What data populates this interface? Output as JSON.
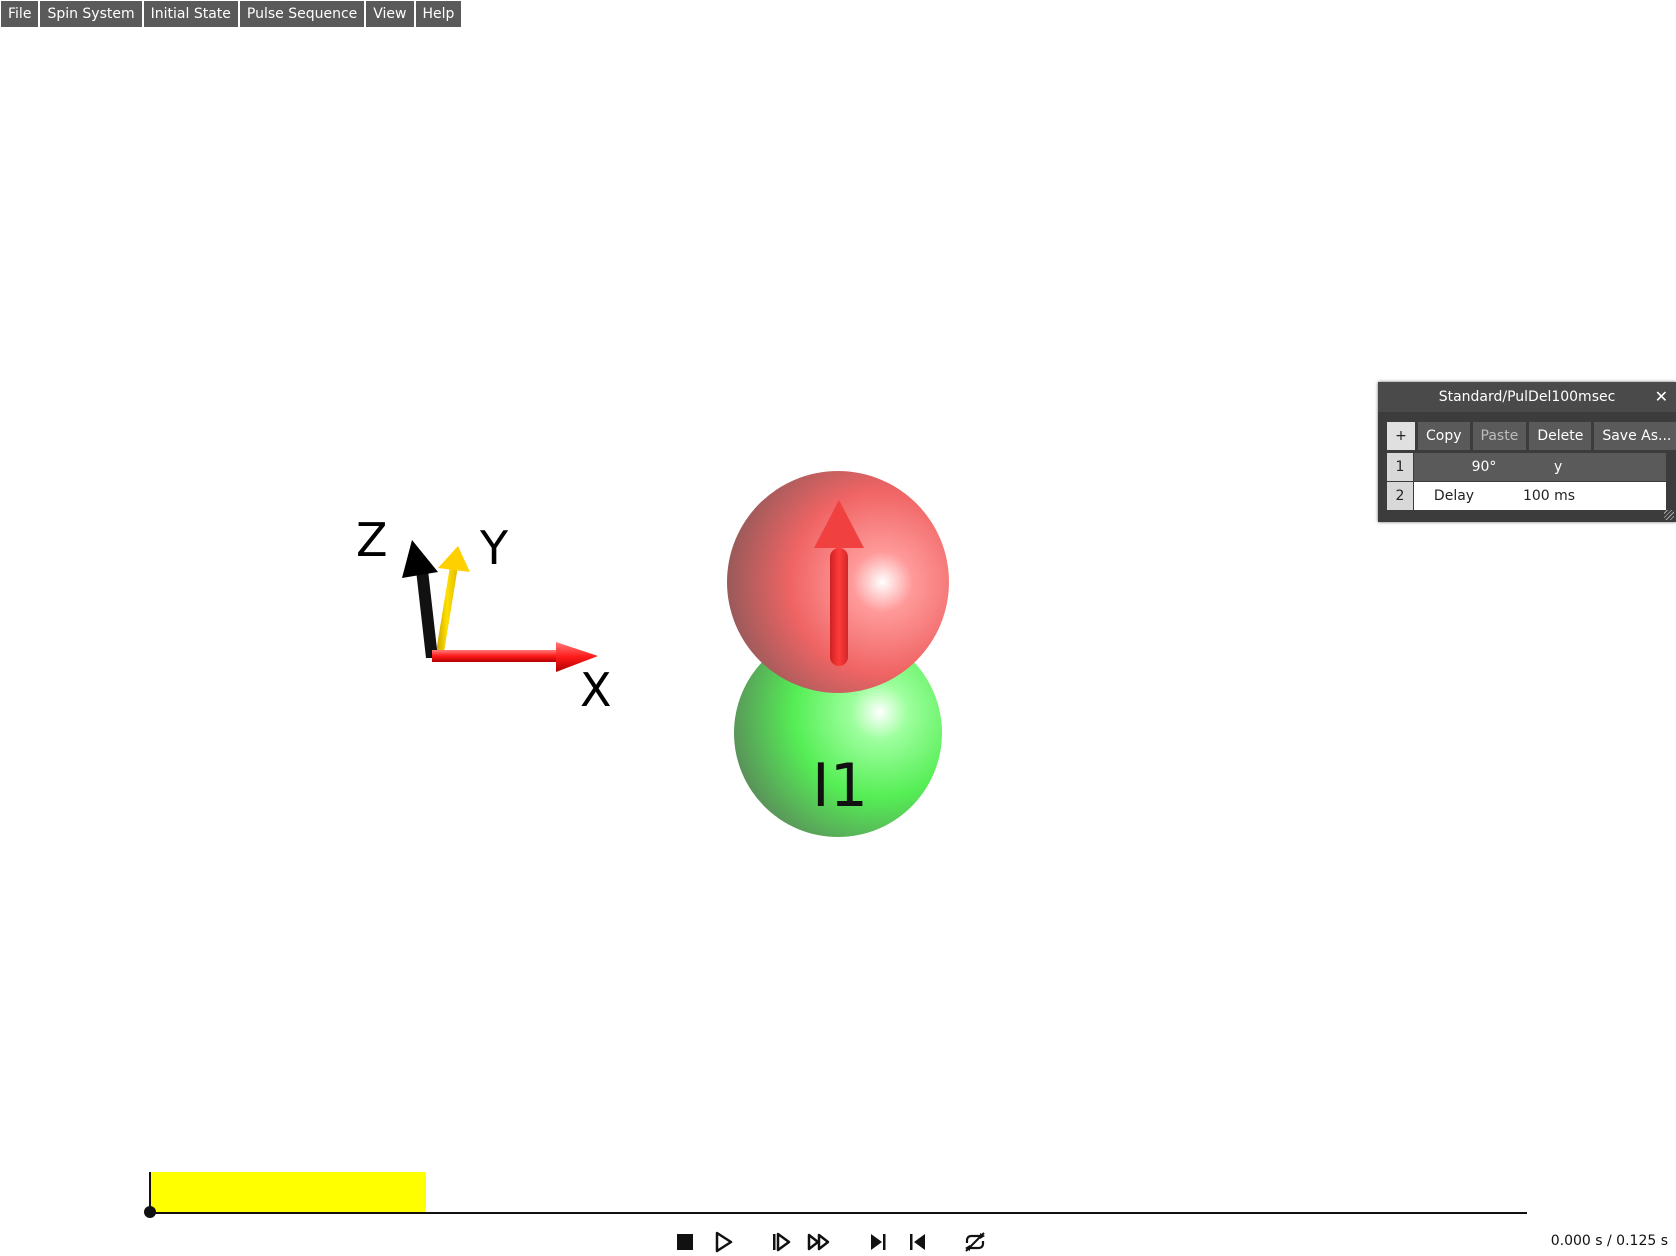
{
  "menu": {
    "items": [
      "File",
      "Spin System",
      "Initial State",
      "Pulse Sequence",
      "View",
      "Help"
    ]
  },
  "scene": {
    "axes": {
      "x_label": "X",
      "y_label": "Y",
      "z_label": "Z"
    },
    "spin_label": "I1",
    "colors": {
      "x_axis": "#ff2a2a",
      "y_axis": "#ffd000",
      "z_axis": "#000000",
      "spin_sphere": "#ff6a6a",
      "nucleus_sphere": "#66ff66",
      "magnetization_vector": "#ff3333"
    }
  },
  "sequence_panel": {
    "title": "Standard/PulDel100msec",
    "close_icon": "close-icon",
    "toolbar": {
      "add": "+",
      "copy": "Copy",
      "paste": "Paste",
      "delete": "Delete",
      "save_as": "Save As..."
    },
    "rows": [
      {
        "index": "1",
        "col1": "90°",
        "col2": "y"
      },
      {
        "index": "2",
        "col1": "Delay",
        "col2": "100 ms"
      }
    ]
  },
  "timeline": {
    "pulse_color": "#ffff00",
    "pulse_duration_fraction": 0.2
  },
  "transport": {
    "icons": [
      "stop-icon",
      "play-icon",
      "step-forward-icon",
      "fast-forward-icon",
      "skip-to-end-icon",
      "skip-to-start-icon",
      "loop-icon"
    ],
    "time_display": "0.000 s / 0.125 s"
  }
}
